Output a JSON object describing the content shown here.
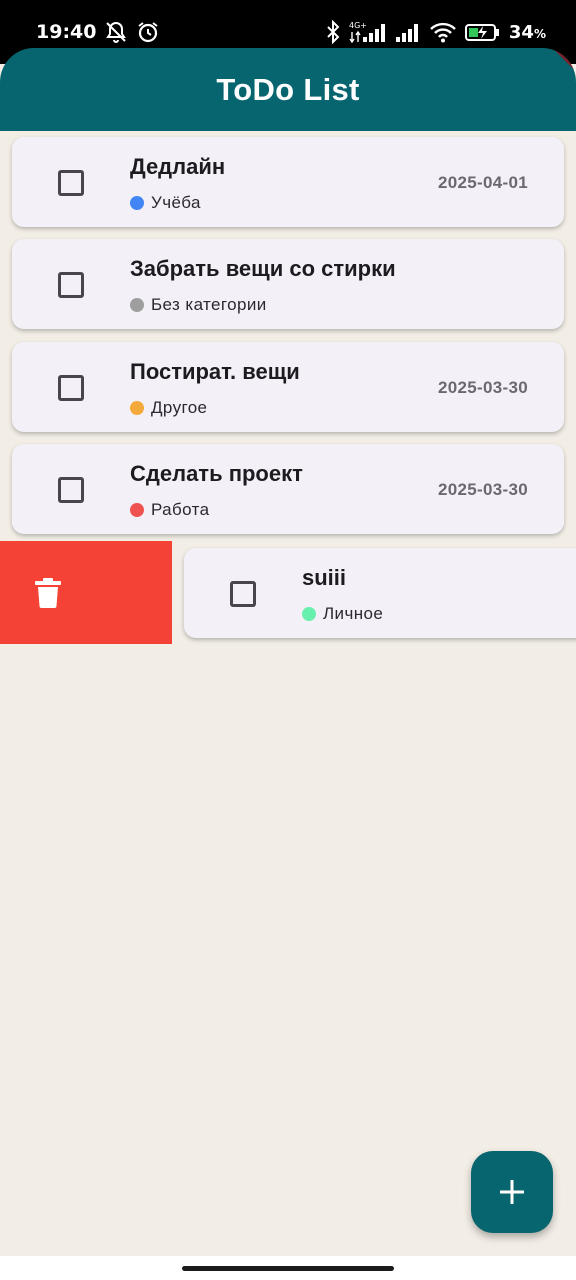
{
  "status_bar": {
    "time": "19:40",
    "battery": "34",
    "battery_unit": "%",
    "network_label": "4G+",
    "icons": [
      "bell-off-icon",
      "alarm-icon",
      "bluetooth-icon",
      "signal-icon",
      "signal-icon",
      "wifi-icon",
      "battery-charging-icon"
    ]
  },
  "app_bar": {
    "title": "ToDo List",
    "color": "#07656f"
  },
  "todos": [
    {
      "title": "Дедлайн",
      "category": "Учёба",
      "category_color": "#4285f4",
      "date": "2025-04-01",
      "checked": false
    },
    {
      "title": "Забрать вещи со стирки",
      "category": "Без категории",
      "category_color": "#9e9e9e",
      "date": "",
      "checked": false
    },
    {
      "title": "Постират. вещи",
      "category": "Другое",
      "category_color": "#f4a93b",
      "date": "2025-03-30",
      "checked": false
    },
    {
      "title": "Сделать проект",
      "category": "Работа",
      "category_color": "#ef5350",
      "date": "2025-03-30",
      "checked": false
    },
    {
      "title": "suiii",
      "category": "Личное",
      "category_color": "#69f0ae",
      "date": "",
      "checked": false,
      "swipe_action": "delete-icon"
    }
  ],
  "colors": {
    "delete_background": "#f44336",
    "fab": "#07656f",
    "background": "#f2eee6"
  },
  "fab": {
    "icon": "plus-icon"
  }
}
